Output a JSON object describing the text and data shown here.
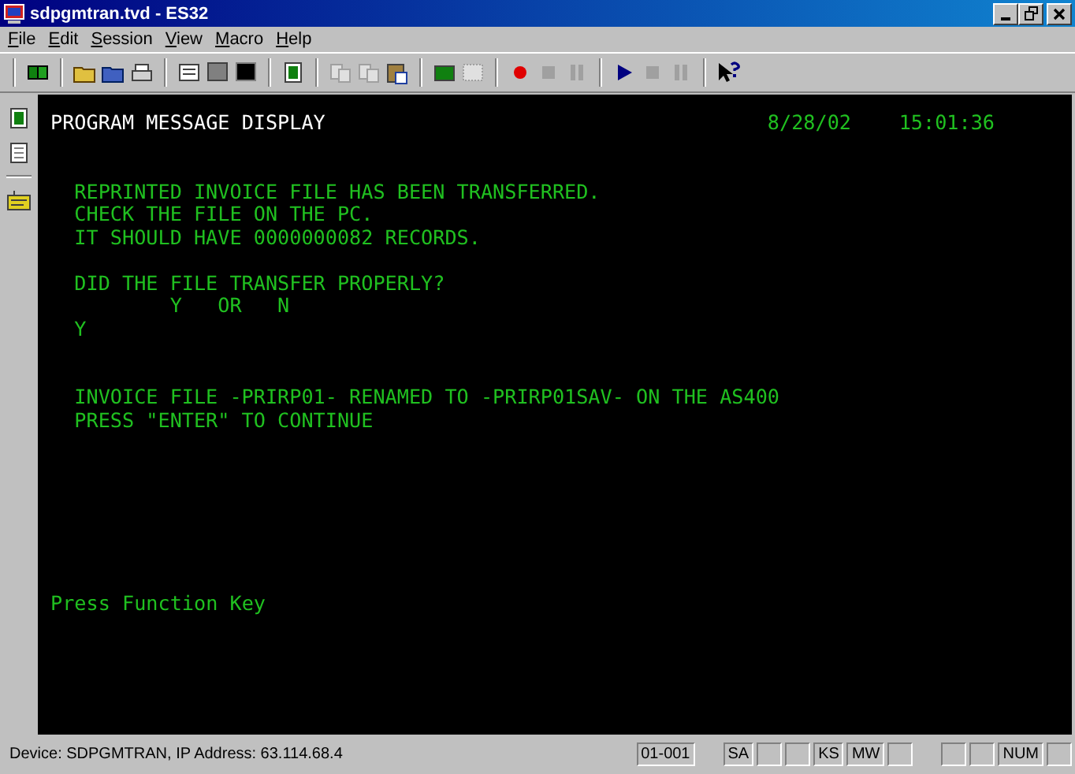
{
  "window": {
    "title": "sdpgmtran.tvd - ES32"
  },
  "menu": [
    "File",
    "Edit",
    "Session",
    "View",
    "Macro",
    "Help"
  ],
  "terminal": {
    "title": "PROGRAM MESSAGE DISPLAY",
    "date": "8/28/02",
    "time": "15:01:36",
    "message": [
      "REPRINTED INVOICE FILE HAS BEEN TRANSFERRED.",
      "CHECK THE FILE ON THE PC.",
      "IT SHOULD HAVE 0000000082 RECORDS."
    ],
    "question": "DID THE FILE TRANSFER PROPERLY?",
    "choices": "Y   OR   N",
    "answer": "Y",
    "notice": [
      "INVOICE FILE -PRIRP01- RENAMED TO -PRIRP01SAV- ON THE AS400",
      "PRESS \"ENTER\" TO CONTINUE"
    ],
    "footer": "Press Function Key"
  },
  "status_bar": {
    "device": "Device: SDPGMTRAN, IP Address: 63.114.68.4",
    "panels": [
      {
        "kind": "text",
        "text": "01-001"
      },
      {
        "kind": "gap"
      },
      {
        "kind": "text",
        "text": "SA"
      },
      {
        "kind": "blank"
      },
      {
        "kind": "blank"
      },
      {
        "kind": "text",
        "text": "KS"
      },
      {
        "kind": "text",
        "text": "MW"
      },
      {
        "kind": "blank"
      },
      {
        "kind": "gap"
      },
      {
        "kind": "blank"
      },
      {
        "kind": "blank"
      },
      {
        "kind": "text",
        "text": "NUM"
      },
      {
        "kind": "blank"
      }
    ]
  }
}
